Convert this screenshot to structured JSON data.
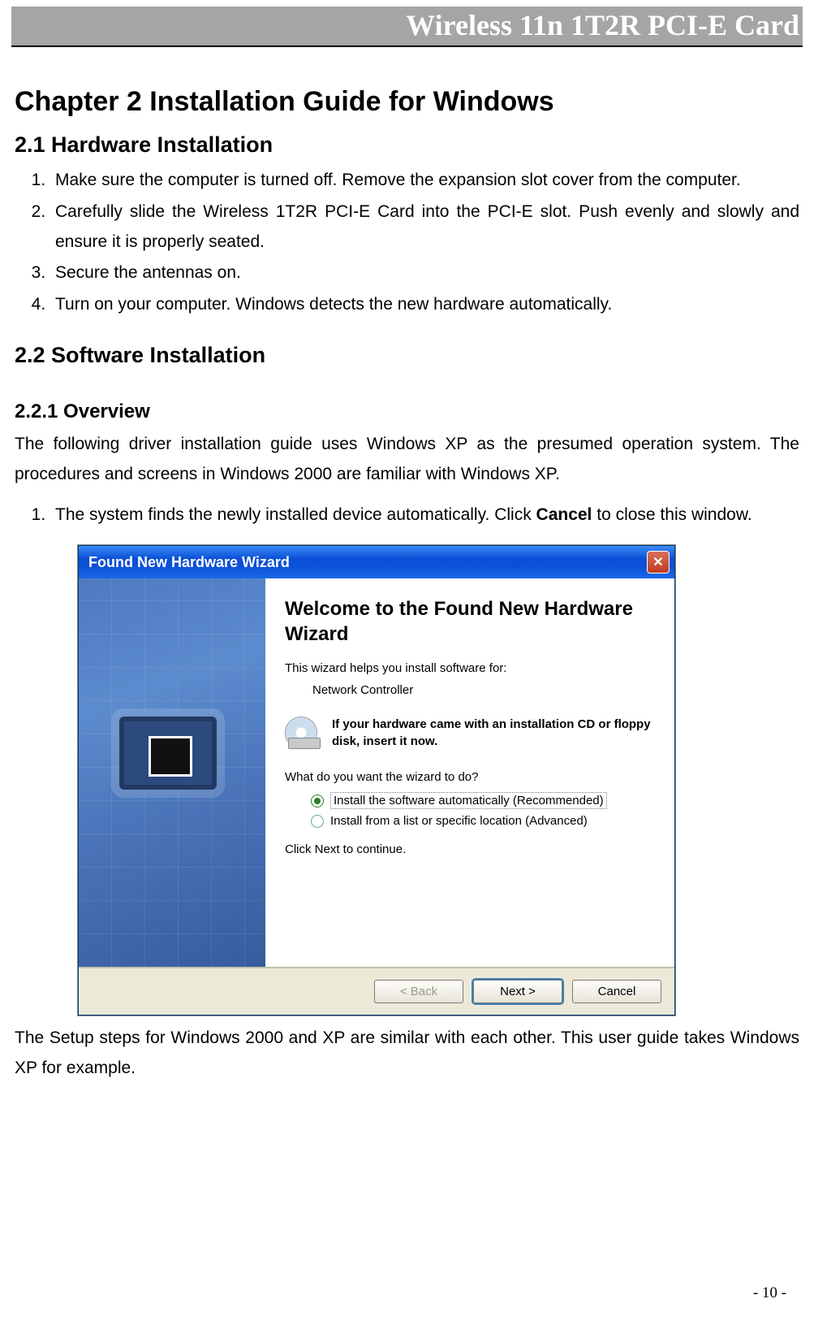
{
  "header": {
    "product": "Wireless 11n 1T2R PCI-E Card"
  },
  "chapter": {
    "title": "Chapter 2   Installation Guide for Windows"
  },
  "section21": {
    "heading": "2.1 Hardware Installation",
    "items": [
      "Make sure the computer is turned off. Remove the expansion slot cover from the computer.",
      "Carefully slide the Wireless 1T2R PCI-E Card into the PCI-E slot. Push evenly and slowly and ensure it is properly seated.",
      "Secure the antennas on.",
      "Turn on your computer. Windows detects the new hardware automatically."
    ]
  },
  "section22": {
    "heading": "2.2 Software Installation"
  },
  "section221": {
    "heading": "2.2.1    Overview",
    "para": "The following driver installation guide uses Windows XP as the presumed operation system. The procedures and screens in Windows 2000 are familiar with Windows XP.",
    "step1_pre": "The system finds the newly installed device automatically. Click ",
    "step1_bold": "Cancel",
    "step1_post": " to close this window."
  },
  "wizard": {
    "titlebar": "Found New Hardware Wizard",
    "heading": "Welcome to the Found New Hardware Wizard",
    "helps": "This wizard helps you install software for:",
    "device": "Network Controller",
    "cd_text": "If your hardware came with an installation CD or floppy disk, insert it now.",
    "question": "What do you want the wizard to do?",
    "opt_auto": "Install the software automatically (Recommended)",
    "opt_list": "Install from a list or specific location (Advanced)",
    "continue": "Click Next to continue.",
    "btn_back": "< Back",
    "btn_next": "Next >",
    "btn_cancel": "Cancel"
  },
  "after_wizard": "The Setup steps for Windows 2000 and XP are similar with each other. This user guide takes Windows XP for example.",
  "page_number": "- 10 -"
}
